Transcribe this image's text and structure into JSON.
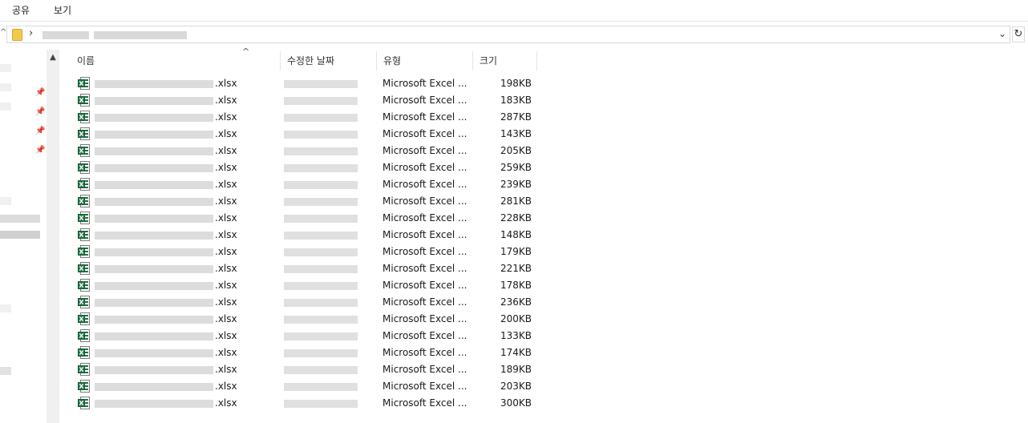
{
  "ribbon": {
    "tabs": [
      "공유",
      "보기"
    ]
  },
  "address": {
    "separator": "›",
    "dropdown_icon": "chevron-down-icon",
    "refresh_icon": "refresh-icon"
  },
  "columns": {
    "name": "이름",
    "modified": "수정한 날짜",
    "type": "유형",
    "size": "크기",
    "sort_indicator": "^"
  },
  "files": [
    {
      "ext": ".xlsx",
      "type": "Microsoft Excel ...",
      "size": "198KB"
    },
    {
      "ext": ".xlsx",
      "type": "Microsoft Excel ...",
      "size": "183KB"
    },
    {
      "ext": ".xlsx",
      "type": "Microsoft Excel ...",
      "size": "287KB"
    },
    {
      "ext": ".xlsx",
      "type": "Microsoft Excel ...",
      "size": "143KB"
    },
    {
      "ext": ".xlsx",
      "type": "Microsoft Excel ...",
      "size": "205KB"
    },
    {
      "ext": ".xlsx",
      "type": "Microsoft Excel ...",
      "size": "259KB"
    },
    {
      "ext": ".xlsx",
      "type": "Microsoft Excel ...",
      "size": "239KB"
    },
    {
      "ext": ".xlsx",
      "type": "Microsoft Excel ...",
      "size": "281KB"
    },
    {
      "ext": ".xlsx",
      "type": "Microsoft Excel ...",
      "size": "228KB"
    },
    {
      "ext": ".xlsx",
      "type": "Microsoft Excel ...",
      "size": "148KB"
    },
    {
      "ext": ".xlsx",
      "type": "Microsoft Excel ...",
      "size": "179KB"
    },
    {
      "ext": ".xlsx",
      "type": "Microsoft Excel ...",
      "size": "221KB"
    },
    {
      "ext": ".xlsx",
      "type": "Microsoft Excel ...",
      "size": "178KB"
    },
    {
      "ext": ".xlsx",
      "type": "Microsoft Excel ...",
      "size": "236KB"
    },
    {
      "ext": ".xlsx",
      "type": "Microsoft Excel ...",
      "size": "200KB"
    },
    {
      "ext": ".xlsx",
      "type": "Microsoft Excel ...",
      "size": "133KB"
    },
    {
      "ext": ".xlsx",
      "type": "Microsoft Excel ...",
      "size": "174KB"
    },
    {
      "ext": ".xlsx",
      "type": "Microsoft Excel ...",
      "size": "189KB"
    },
    {
      "ext": ".xlsx",
      "type": "Microsoft Excel ...",
      "size": "203KB"
    },
    {
      "ext": ".xlsx",
      "type": "Microsoft Excel ...",
      "size": "300KB"
    }
  ],
  "colors": {
    "excel_green": "#217346",
    "folder_yellow": "#f2c94c"
  }
}
